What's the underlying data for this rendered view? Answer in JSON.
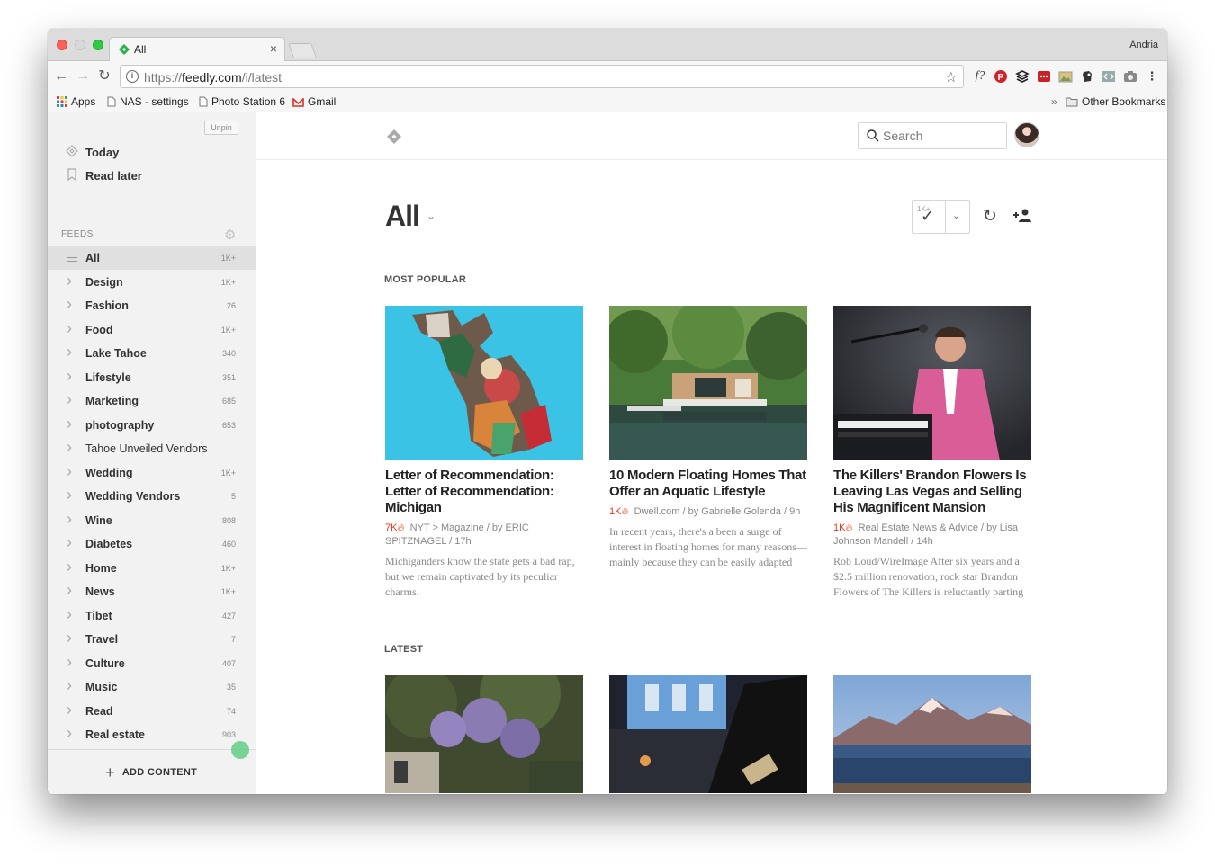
{
  "browser": {
    "tab_title": "All",
    "tab_close": "×",
    "profile_name": "Andria",
    "url_prefix": "https://",
    "url_host": "feedly.com",
    "url_path": "/i/latest",
    "bookmarks": [
      "Apps",
      "NAS - settings",
      "Photo Station 6",
      "Gmail"
    ],
    "bookmarks_overflow": "»",
    "other_bookmarks": "Other Bookmarks",
    "extension_f": "f?"
  },
  "sidebar": {
    "unpin_label": "Unpin",
    "today_label": "Today",
    "read_later_label": "Read later",
    "feeds_heading": "FEEDS",
    "feeds": [
      {
        "name": "All",
        "count": "1K+"
      },
      {
        "name": "Design",
        "count": "1K+"
      },
      {
        "name": "Fashion",
        "count": "26"
      },
      {
        "name": "Food",
        "count": "1K+"
      },
      {
        "name": "Lake Tahoe",
        "count": "340"
      },
      {
        "name": "Lifestyle",
        "count": "351"
      },
      {
        "name": "Marketing",
        "count": "685"
      },
      {
        "name": "photography",
        "count": "653"
      },
      {
        "name": "Tahoe Unveiled Vendors",
        "count": ""
      },
      {
        "name": "Wedding",
        "count": "1K+"
      },
      {
        "name": "Wedding Vendors",
        "count": "5"
      },
      {
        "name": "Wine",
        "count": "808"
      },
      {
        "name": "Diabetes",
        "count": "460"
      },
      {
        "name": "Home",
        "count": "1K+"
      },
      {
        "name": "News",
        "count": "1K+"
      },
      {
        "name": "Tibet",
        "count": "427"
      },
      {
        "name": "Travel",
        "count": "7"
      },
      {
        "name": "Culture",
        "count": "407"
      },
      {
        "name": "Music",
        "count": "35"
      },
      {
        "name": "Read",
        "count": "74"
      },
      {
        "name": "Real estate",
        "count": "903"
      }
    ],
    "add_content_label": "ADD CONTENT"
  },
  "main": {
    "search_placeholder": "Search",
    "page_title": "All",
    "unread_count": "1K+",
    "most_popular_label": "MOST POPULAR",
    "latest_label": "LATEST",
    "popular_cards": [
      {
        "title": "Letter of Recommendation: Letter of Recommendation: Michigan",
        "popularity": "7K",
        "source": "NYT > Magazine / by ERIC SPITZNAGEL / 17h",
        "summary": "Michiganders know the state gets a bad rap, but we remain captivated by its peculiar charms."
      },
      {
        "title": "10 Modern Floating Homes That Offer an Aquatic Lifestyle",
        "popularity": "1K",
        "source": "Dwell.com / by Gabrielle Golenda / 9h",
        "summary": "In recent years, there's a been a surge of interest in floating homes for many reasons—mainly because they can be easily adapted"
      },
      {
        "title": "The Killers' Brandon Flowers Is Leaving Las Vegas and Selling His Magnificent Mansion",
        "popularity": "1K",
        "source": "Real Estate News & Advice / by Lisa Johnson Mandell / 14h",
        "summary": "Rob Loud/WireImage After six years and a $2.5 million renovation, rock star Brandon Flowers of The Killers is reluctantly parting"
      }
    ]
  },
  "colors": {
    "feedly_green": "#2bb24c",
    "popularity_red": "#e8361a",
    "sidebar_bg": "#f2f2f2"
  }
}
